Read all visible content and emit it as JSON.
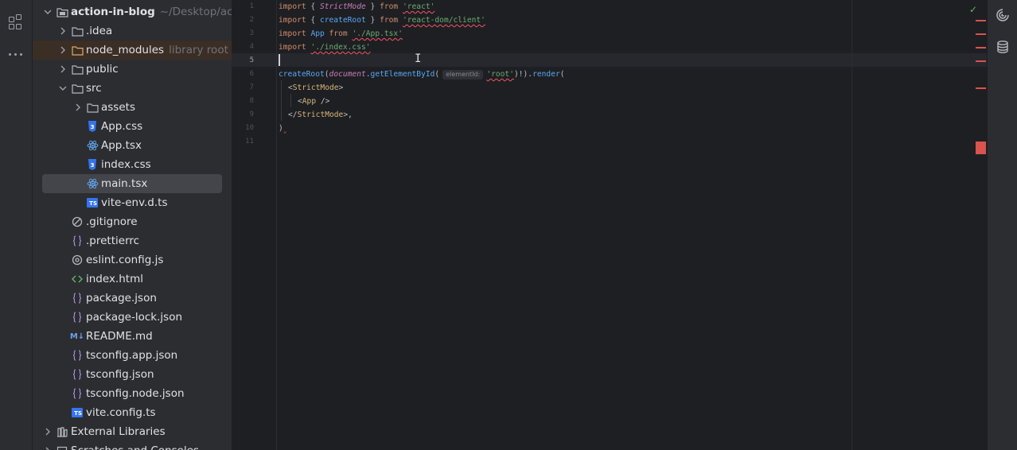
{
  "left_toolbar": {
    "icons": [
      "structure-icon",
      "more-icon"
    ]
  },
  "project_tree": {
    "root": {
      "name": "action-in-blog",
      "path": "~/Desktop/action"
    },
    "items": [
      {
        "name": ".idea",
        "kind": "folder",
        "depth": 1,
        "collapsed": true
      },
      {
        "name": "node_modules",
        "kind": "folder",
        "depth": 1,
        "collapsed": true,
        "hint": "library root",
        "excluded": true
      },
      {
        "name": "public",
        "kind": "folder",
        "depth": 1,
        "collapsed": true
      },
      {
        "name": "src",
        "kind": "folder",
        "depth": 1,
        "collapsed": false
      },
      {
        "name": "assets",
        "kind": "folder",
        "depth": 2,
        "collapsed": true
      },
      {
        "name": "App.css",
        "kind": "css",
        "depth": 2
      },
      {
        "name": "App.tsx",
        "kind": "react",
        "depth": 2
      },
      {
        "name": "index.css",
        "kind": "css",
        "depth": 2
      },
      {
        "name": "main.tsx",
        "kind": "react",
        "depth": 2,
        "selected": true
      },
      {
        "name": "vite-env.d.ts",
        "kind": "ts",
        "depth": 2
      },
      {
        "name": ".gitignore",
        "kind": "ignore",
        "depth": 1
      },
      {
        "name": ".prettierrc",
        "kind": "json",
        "depth": 1
      },
      {
        "name": "eslint.config.js",
        "kind": "config",
        "depth": 1
      },
      {
        "name": "index.html",
        "kind": "html",
        "depth": 1
      },
      {
        "name": "package.json",
        "kind": "json",
        "depth": 1
      },
      {
        "name": "package-lock.json",
        "kind": "json",
        "depth": 1
      },
      {
        "name": "README.md",
        "kind": "md",
        "depth": 1
      },
      {
        "name": "tsconfig.app.json",
        "kind": "json",
        "depth": 1
      },
      {
        "name": "tsconfig.json",
        "kind": "json",
        "depth": 1
      },
      {
        "name": "tsconfig.node.json",
        "kind": "json",
        "depth": 1
      },
      {
        "name": "vite.config.ts",
        "kind": "ts",
        "depth": 1
      }
    ],
    "external_libraries": "External Libraries",
    "scratches": "Scratches and Consoles",
    "badges": {
      "ts": "TS",
      "md": "M↓"
    }
  },
  "editor": {
    "file": "main.tsx",
    "current_line": 5,
    "line_numbers": [
      "1",
      "2",
      "3",
      "4",
      "5",
      "6",
      "7",
      "8",
      "9",
      "10",
      "11"
    ],
    "code": {
      "l1": {
        "kw1": "import",
        "p1": " { ",
        "name": "StrictMode",
        "p2": " } ",
        "kw2": "from",
        "str": "'react'"
      },
      "l2": {
        "kw1": "import",
        "p1": " { ",
        "name": "createRoot",
        "p2": " } ",
        "kw2": "from",
        "str": "'react-dom/client'"
      },
      "l3": {
        "kw1": "import",
        "name": "App",
        "kw2": "from",
        "str": "'./App.tsx'"
      },
      "l4": {
        "kw1": "import",
        "str": "'./index.css'"
      },
      "l6": {
        "fn1": "createRoot",
        "p1": "(",
        "obj": "document",
        "dot": ".",
        "fn2": "getElementById",
        "p2": "(",
        "hint": "elementId:",
        "str": "'root'",
        "p3": ")!).",
        "fn3": "render",
        "p4": "("
      },
      "l7": {
        "open": "<",
        "tag": "StrictMode",
        "close": ">"
      },
      "l8": {
        "open": "<",
        "tag": "App",
        "close": " />"
      },
      "l9": {
        "open": "</",
        "tag": "StrictMode",
        "close": ">,"
      },
      "l10": {
        "text": ")"
      }
    }
  },
  "colors": {
    "keyword": "#cf8e6d",
    "string": "#6aab73",
    "function": "#56a8f5",
    "tag": "#d5b778",
    "error": "#d9534f",
    "ok": "#5fb865"
  },
  "right_toolbar": {
    "icons": [
      "ai-assistant-icon",
      "database-icon"
    ]
  }
}
